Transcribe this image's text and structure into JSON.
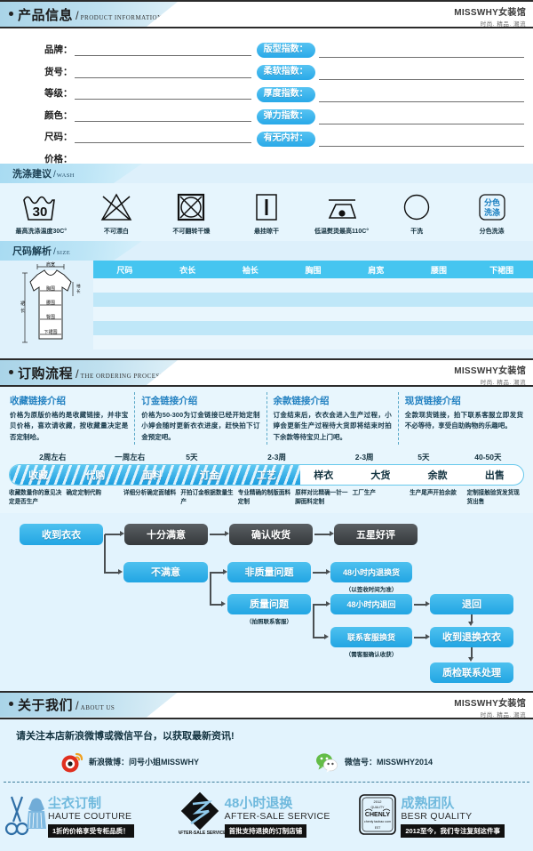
{
  "brand": {
    "name": "MISSWHY女装馆",
    "tagline": "时尚. 精品. 潮流"
  },
  "sections": {
    "product": {
      "cn": "产品信息",
      "en": "PRODUCT INFORMATION"
    },
    "wash": {
      "cn": "洗涤建议",
      "en": "WASH"
    },
    "size": {
      "cn": "尺码解析",
      "en": "SIZE"
    },
    "order": {
      "cn": "订购流程",
      "en": "THE ORDERING PROCESS"
    },
    "about": {
      "cn": "关于我们",
      "en": "ABOUT US"
    }
  },
  "product_fields_left": [
    "品牌：",
    "货号：",
    "等级：",
    "颜色：",
    "尺码：",
    "价格："
  ],
  "product_fields_right": [
    "版型指数：",
    "柔软指数：",
    "厚度指数：",
    "弹力指数：",
    "有无内衬："
  ],
  "wash_items": [
    {
      "icon": "wash-tub-30-icon",
      "caption": "最高洗涤温度30C°"
    },
    {
      "icon": "no-bleach-triangle-icon",
      "caption": "不可漂白"
    },
    {
      "icon": "no-tumble-dry-icon",
      "caption": "不可翻转干燥"
    },
    {
      "icon": "line-dry-hang-icon",
      "caption": "悬挂晾干"
    },
    {
      "icon": "iron-low-temp-icon",
      "caption": "低温熨烫最高110C°"
    },
    {
      "icon": "dry-clean-circle-icon",
      "caption": "干洗"
    },
    {
      "icon": "separate-wash-icon",
      "caption": "分色洗涤"
    }
  ],
  "size_table": {
    "columns": [
      "尺码",
      "衣长",
      "袖长",
      "胸围",
      "肩宽",
      "腰围",
      "下裙围"
    ],
    "rows": [
      [],
      [],
      [],
      [],
      []
    ]
  },
  "size_figure_labels": [
    "肩宽",
    "胸围",
    "腰围",
    "臀围",
    "下裙围",
    "袖长",
    "裙长"
  ],
  "order_intro": [
    {
      "title": "收藏链接介绍",
      "body": "价格为原版价格的是收藏链接，并非宝贝价格，喜欢请收藏，按收藏量决定是否定制哈。"
    },
    {
      "title": "订金链接介绍",
      "body": "价格为50-300为订金链接已经开始定制小婷会随时更新衣衣进度，赶快拍下订金预定吧。"
    },
    {
      "title": "余款链接介绍",
      "body": "订金结束后，衣衣会进入生产过程，小婷会更新生产过程待大货即将结束时拍下余款等待宝贝上门吧。"
    },
    {
      "title": "现货链接介绍",
      "body": "全款现货链接，拍下联系客服立即发货不必等待，享受自助购物的乐趣吧。"
    }
  ],
  "timeline": {
    "times": [
      "2周左右",
      "一周左右",
      "5天",
      "2-3周",
      "2-3周",
      "5天",
      "40-50天"
    ],
    "stages": [
      {
        "label": "收藏",
        "highlighted": true
      },
      {
        "label": "代购",
        "highlighted": true
      },
      {
        "label": "面料",
        "highlighted": true
      },
      {
        "label": "订金",
        "highlighted": true
      },
      {
        "label": "工艺",
        "highlighted": true
      },
      {
        "label": "样衣",
        "highlighted": false
      },
      {
        "label": "大货",
        "highlighted": false
      },
      {
        "label": "余款",
        "highlighted": false
      },
      {
        "label": "出售",
        "highlighted": false
      }
    ],
    "descriptions": [
      "收藏数量你的意见决定是否生产",
      "确定定制代购",
      "详细分析确定面辅料",
      "开拍订金根据数量生产",
      "专业精确的制版面料定制",
      "原样对比精确一针一脚面料定制",
      "工厂生产",
      "生产尾声开拍余款",
      "定制接触验货发货现货出售"
    ]
  },
  "flow": {
    "n1": "收到衣衣",
    "n2": "十分满意",
    "n3": "确认收货",
    "n4": "五星好评",
    "n5": "不满意",
    "n6": "非质量问题",
    "n7": "48小时内退换货",
    "n7sub": "（以签收时间为准）",
    "n8": "质量问题",
    "n8sub": "（拍照联系客服）",
    "n9": "48小时内退回",
    "n10": "退回",
    "n11": "联系客服换货",
    "n11sub": "（需客服确认收获）",
    "n12": "收到退换衣衣",
    "n13": "质检联系处理"
  },
  "about": {
    "title": "请关注本店新浪微博或微信平台，以获取最新资讯!",
    "weibo": {
      "icon": "weibo-icon",
      "text": "新浪微博：问号小姐MISSWHY"
    },
    "wechat": {
      "icon": "wechat-icon",
      "text": "微信号：MISSWHY2014"
    }
  },
  "badges": [
    {
      "icon": "scissors-dress-icon",
      "cn": "尘衣订制",
      "en": "HAUTE COUTURE",
      "tag": "1折的价格享受专柜品质！"
    },
    {
      "icon": "after-sale-diamond-icon",
      "cn": "48小时退换",
      "en": "AFTER-SALE SERVICE",
      "tag": "首批支持退换的订制店铺",
      "iconLabel": "AFTER-SALE SERVICE"
    },
    {
      "icon": "chenly-seal-icon",
      "cn": "成熟团队",
      "en": "BESR QUALITY",
      "tag": "2012至今，我们专注复刻这件事"
    }
  ],
  "colors": {
    "accent_blue": "#29a9e8",
    "header_tab": "#a9d4e8",
    "panel_bg": "#e2f3fd",
    "dark_node": "#35393c"
  }
}
